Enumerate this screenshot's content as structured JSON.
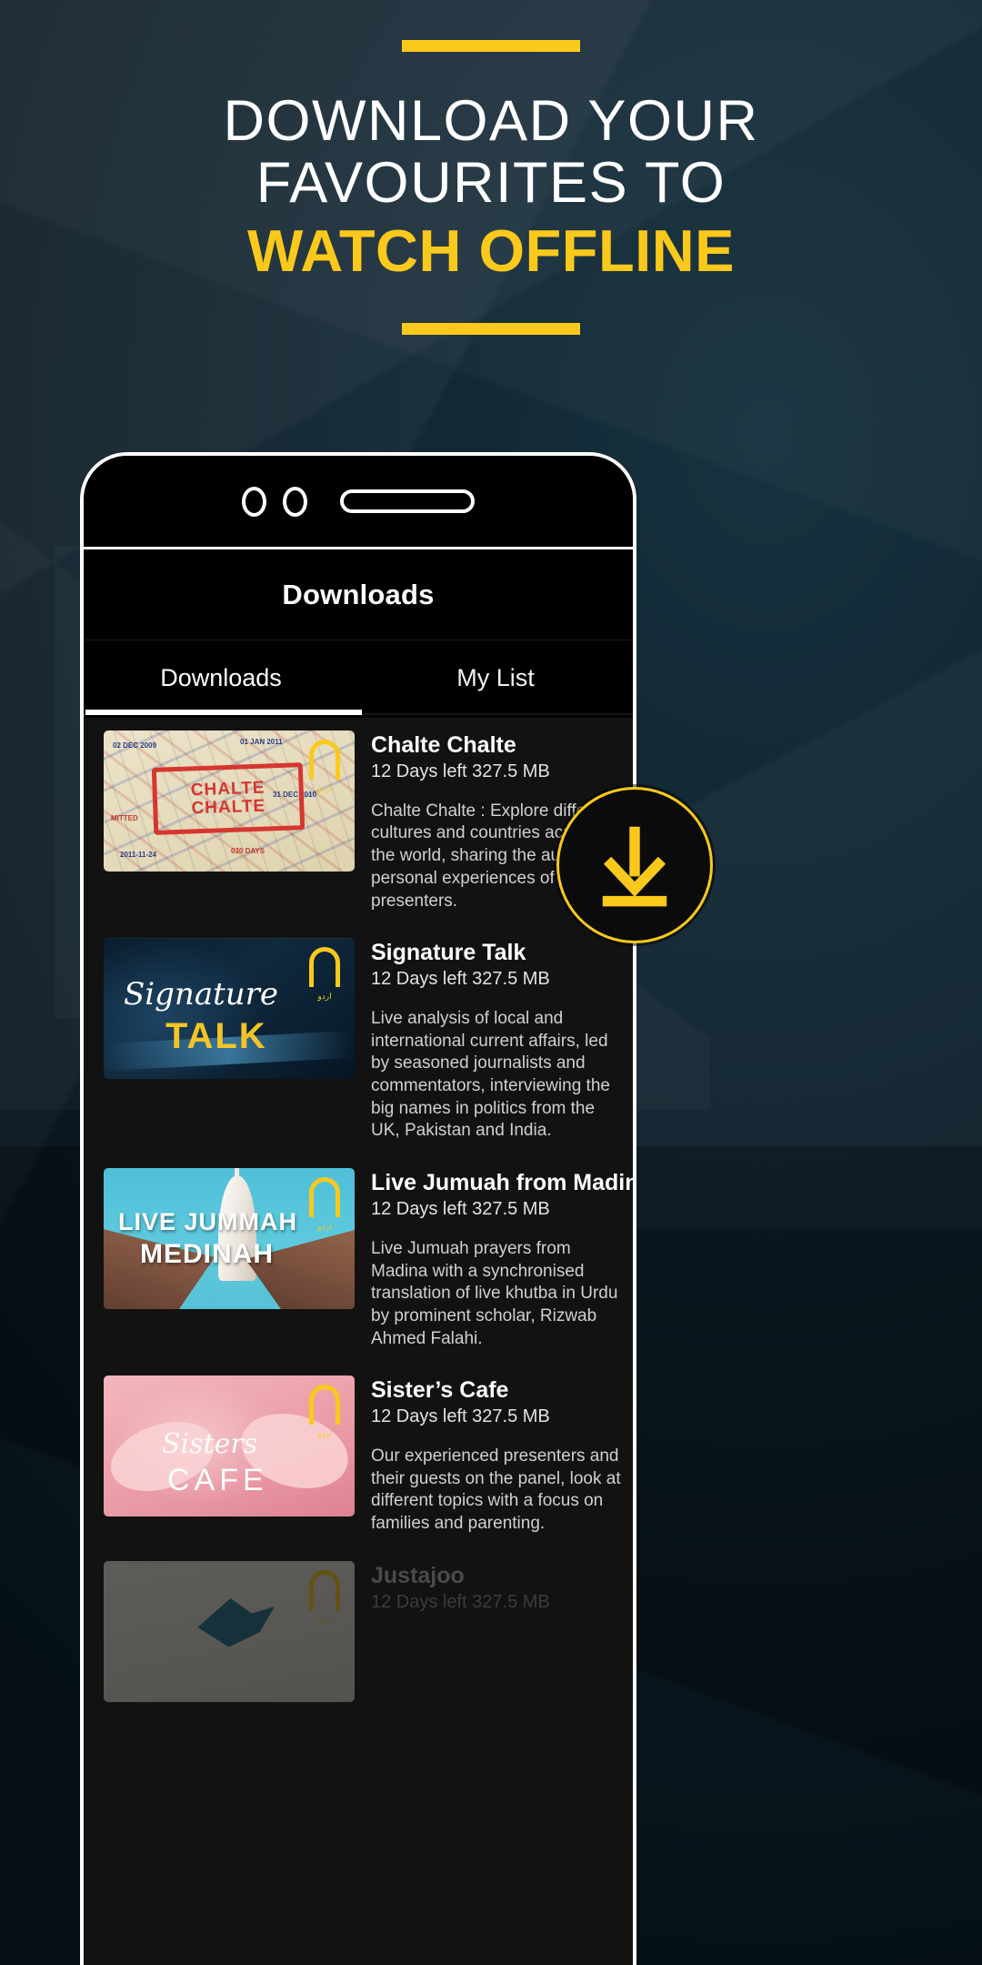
{
  "promo": {
    "headline_line1": "DOWNLOAD YOUR",
    "headline_line2": "FAVOURITES TO",
    "headline_line3": "WATCH OFFLINE",
    "accent_color": "#fbc91b",
    "background_color": "#0b1a22"
  },
  "phone": {
    "notch": {
      "camera_icon": "camera-dot-icon",
      "speaker_icon": "speaker-grill-icon"
    }
  },
  "app": {
    "title": "Downloads",
    "tabs": [
      {
        "label": "Downloads",
        "active": true
      },
      {
        "label": "My List",
        "active": false
      }
    ],
    "download_fab": {
      "icon": "download-arrow-icon",
      "color": "#fbc91b"
    },
    "items": [
      {
        "title": "Chalte Chalte",
        "meta": "12 Days left 327.5 MB",
        "description": "Chalte Chalte : Explore different cultures and countries across the world, sharing the authentic, personal experiences of our presenters.",
        "badge_label": "اردو",
        "thumb_text_line1": "CHALTE",
        "thumb_text_line2": "CHALTE",
        "dimmed": false
      },
      {
        "title": "Signature Talk",
        "meta": "12 Days left 327.5 MB",
        "description": "Live analysis of local and international current affairs, led by seasoned journalists and commentators, interviewing the big names in politics from the UK, Pakistan and India.",
        "badge_label": "اردو",
        "thumb_text_line1": "Signature",
        "thumb_text_line2": "TALK",
        "dimmed": false
      },
      {
        "title": "Live Jumuah from Madinah",
        "meta": "12 Days left 327.5 MB",
        "description": "Live Jumuah prayers from Madina with a synchronised translation of live khutba in Urdu by prominent scholar, Rizwab Ahmed Falahi.",
        "badge_label": "اردو",
        "thumb_text_line1": "LIVE JUMMAH",
        "thumb_text_line2": "MEDINAH",
        "dimmed": false
      },
      {
        "title": "Sister’s Cafe",
        "meta": "12 Days left 327.5 MB",
        "description": "Our experienced presenters and their guests on the panel, look at different topics with a focus on families and parenting.",
        "badge_label": "اردو",
        "thumb_text_line1": "Sisters",
        "thumb_text_line2": "CAFE",
        "dimmed": false
      },
      {
        "title": "Justajoo",
        "meta": "12 Days left 327.5 MB",
        "description": "",
        "badge_label": "اردو",
        "thumb_text_line1": "",
        "thumb_text_line2": "",
        "dimmed": true
      }
    ]
  }
}
